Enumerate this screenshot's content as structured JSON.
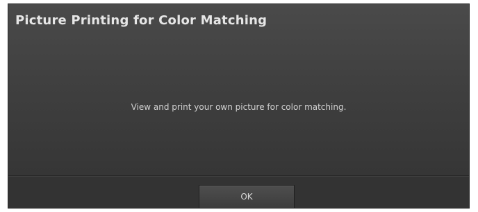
{
  "dialog": {
    "title": "Picture Printing for Color Matching",
    "message": "View and print your own picture for color matching.",
    "ok_label": "OK"
  },
  "colors": {
    "background_top": "#4a4a4a",
    "background_bottom": "#363636",
    "footer": "#333333",
    "title_text": "#e6e6e6",
    "body_text": "#d2d2d2"
  }
}
